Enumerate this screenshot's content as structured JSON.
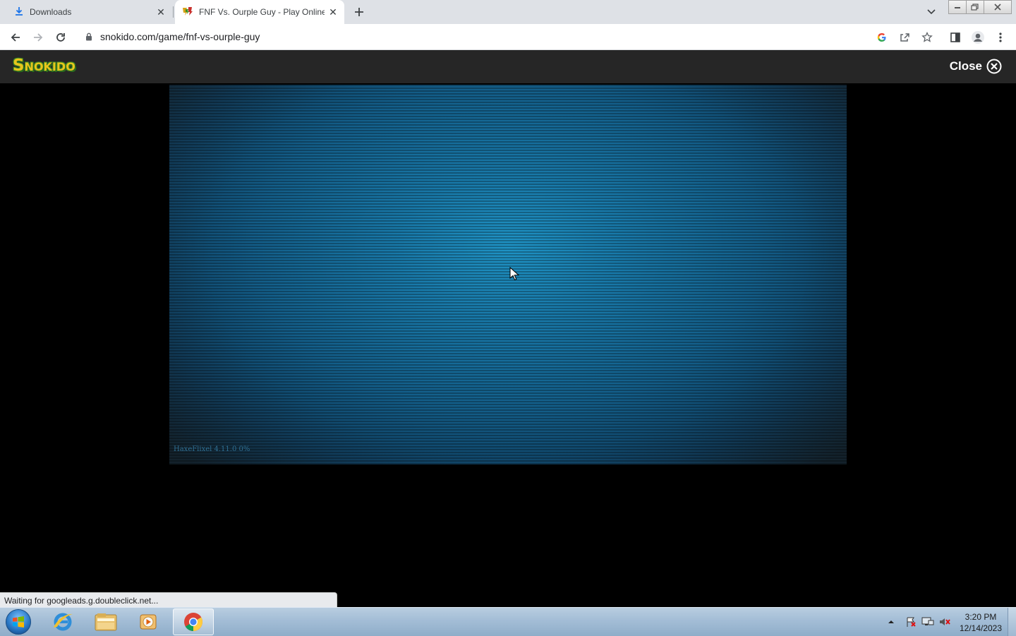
{
  "browser": {
    "tabs": [
      {
        "title": "Downloads",
        "icon": "download-icon",
        "active": false
      },
      {
        "title": "FNF Vs. Ourple Guy - Play Online",
        "icon": "snokido-favicon",
        "active": true
      }
    ],
    "url": "snokido.com/game/fnf-vs-ourple-guy",
    "status_text": "Waiting for googleads.g.doubleclick.net..."
  },
  "site": {
    "logo_text": "Snokido",
    "close_label": "Close"
  },
  "game": {
    "engine_label": "HaxeFlixel 4.11.0 0%"
  },
  "taskbar": {
    "apps": [
      "internet-explorer",
      "file-explorer",
      "media-player",
      "chrome"
    ],
    "active_app": "chrome",
    "time": "3:20 PM",
    "date": "12/14/2023"
  },
  "colors": {
    "tabstrip": "#dee1e6",
    "site_header": "#262626",
    "game_center": "#1f93c5",
    "logo_yellow": "#e8c51c",
    "logo_green": "#3f8f24"
  }
}
